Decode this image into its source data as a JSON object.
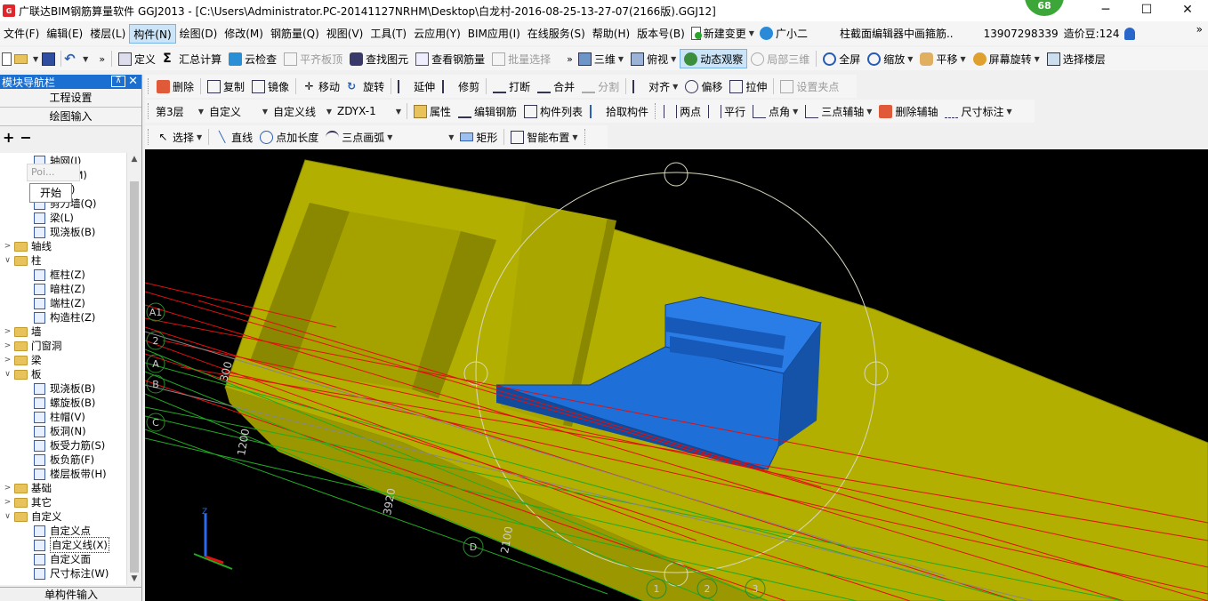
{
  "window": {
    "title": "广联达BIM钢筋算量软件 GGJ2013 - [C:\\Users\\Administrator.PC-20141127NRHM\\Desktop\\白龙村-2016-08-25-13-27-07(2166版).GGJ12]",
    "badge": "68",
    "minimize": "─",
    "maximize": "☐",
    "close": "✕"
  },
  "menu": {
    "items": [
      "文件(F)",
      "编辑(E)",
      "楼层(L)",
      "构件(N)",
      "绘图(D)",
      "修改(M)",
      "钢筋量(Q)",
      "视图(V)",
      "工具(T)",
      "云应用(Y)",
      "BIM应用(I)",
      "在线服务(S)",
      "帮助(H)",
      "版本号(B)"
    ],
    "new_change": "新建变更",
    "guangxiaoer": "广小二",
    "notice": "柱截面编辑器中画箍筋..",
    "phone": "13907298339",
    "price_bean": "造价豆:124",
    "more": "»"
  },
  "toolbar1": {
    "define": "定义",
    "sum": "汇总计算",
    "cloud_check": "云检查",
    "align_top": "平齐板顶",
    "find": "查找图元",
    "view_rebar": "查看钢筋量",
    "batch_select": "批量选择",
    "more": "»",
    "three_d": "三维",
    "top_view": "俯视",
    "dynamic_view": "动态观察",
    "local_3d": "局部三维",
    "fullscreen": "全屏",
    "zoom": "缩放",
    "pan": "平移",
    "rotate_screen": "屏幕旋转",
    "select_floor": "选择楼层"
  },
  "toolbar2": {
    "delete": "删除",
    "copy": "复制",
    "mirror": "镜像",
    "move": "移动",
    "rotate": "旋转",
    "extend": "延伸",
    "trim": "修剪",
    "break": "打断",
    "merge": "合并",
    "split": "分割",
    "align": "对齐",
    "offset": "偏移",
    "stretch": "拉伸",
    "set_grip": "设置夹点"
  },
  "toolbar3": {
    "floor": "第3层",
    "custom": "自定义",
    "custom_line": "自定义线",
    "component": "ZDYX-1",
    "property": "属性",
    "edit_rebar": "编辑钢筋",
    "component_list": "构件列表",
    "pick_component": "拾取构件",
    "two_points": "两点",
    "parallel": "平行",
    "point_angle": "点角",
    "three_point_aux": "三点辅轴",
    "delete_aux": "删除辅轴",
    "dimension": "尺寸标注"
  },
  "toolbar4": {
    "select": "选择",
    "line": "直线",
    "point_length": "点加长度",
    "three_point_arc": "三点画弧",
    "rectangle": "矩形",
    "smart_layout": "智能布置"
  },
  "left_panel": {
    "title": "模块导航栏",
    "pin": "⊼",
    "close": "✕",
    "project_settings": "工程设置",
    "drawing_input": "绘图输入",
    "single_input": "单构件输入",
    "popup_poi": "Poi...",
    "popup_start": "开始",
    "tree": [
      {
        "label": "轴网(J)",
        "level": 2,
        "type": "leaf"
      },
      {
        "label": "基础(M)",
        "level": 2,
        "type": "leaf"
      },
      {
        "label": "柱(Z)",
        "level": 2,
        "type": "leaf"
      },
      {
        "label": "剪力墙(Q)",
        "level": 2,
        "type": "leaf"
      },
      {
        "label": "梁(L)",
        "level": 2,
        "type": "leaf"
      },
      {
        "label": "现浇板(B)",
        "level": 2,
        "type": "leaf"
      },
      {
        "label": "轴线",
        "level": 1,
        "type": "folder",
        "state": "collapsed"
      },
      {
        "label": "柱",
        "level": 1,
        "type": "folder",
        "state": "expanded"
      },
      {
        "label": "框柱(Z)",
        "level": 2,
        "type": "leaf"
      },
      {
        "label": "暗柱(Z)",
        "level": 2,
        "type": "leaf"
      },
      {
        "label": "端柱(Z)",
        "level": 2,
        "type": "leaf"
      },
      {
        "label": "构造柱(Z)",
        "level": 2,
        "type": "leaf"
      },
      {
        "label": "墙",
        "level": 1,
        "type": "folder",
        "state": "collapsed"
      },
      {
        "label": "门窗洞",
        "level": 1,
        "type": "folder",
        "state": "collapsed"
      },
      {
        "label": "梁",
        "level": 1,
        "type": "folder",
        "state": "collapsed"
      },
      {
        "label": "板",
        "level": 1,
        "type": "folder",
        "state": "expanded"
      },
      {
        "label": "现浇板(B)",
        "level": 2,
        "type": "leaf"
      },
      {
        "label": "螺旋板(B)",
        "level": 2,
        "type": "leaf"
      },
      {
        "label": "柱帽(V)",
        "level": 2,
        "type": "leaf"
      },
      {
        "label": "板洞(N)",
        "level": 2,
        "type": "leaf"
      },
      {
        "label": "板受力筋(S)",
        "level": 2,
        "type": "leaf"
      },
      {
        "label": "板负筋(F)",
        "level": 2,
        "type": "leaf"
      },
      {
        "label": "楼层板带(H)",
        "level": 2,
        "type": "leaf"
      },
      {
        "label": "基础",
        "level": 1,
        "type": "folder",
        "state": "collapsed"
      },
      {
        "label": "其它",
        "level": 1,
        "type": "folder",
        "state": "collapsed"
      },
      {
        "label": "自定义",
        "level": 1,
        "type": "folder",
        "state": "expanded"
      },
      {
        "label": "自定义点",
        "level": 2,
        "type": "leaf"
      },
      {
        "label": "自定义线(X)",
        "level": 2,
        "type": "leaf",
        "selected": true
      },
      {
        "label": "自定义面",
        "level": 2,
        "type": "leaf"
      },
      {
        "label": "尺寸标注(W)",
        "level": 2,
        "type": "leaf"
      }
    ]
  },
  "viewport": {
    "axis_labels": [
      "A1",
      "2",
      "A",
      "B",
      "C",
      "D",
      "1",
      "2",
      "3"
    ],
    "dimensions": [
      "300",
      "1200",
      "3920",
      "2100"
    ],
    "colors": {
      "background": "#000000",
      "slab": "#b5b200",
      "blue_component": "#1e6fd8",
      "red_line": "#e01010",
      "green_line": "#22aa22",
      "axis_circle": "#2c8a2c"
    }
  },
  "colors": {
    "accent": "#1a6fd1",
    "menu_active": "#cce4f7"
  }
}
